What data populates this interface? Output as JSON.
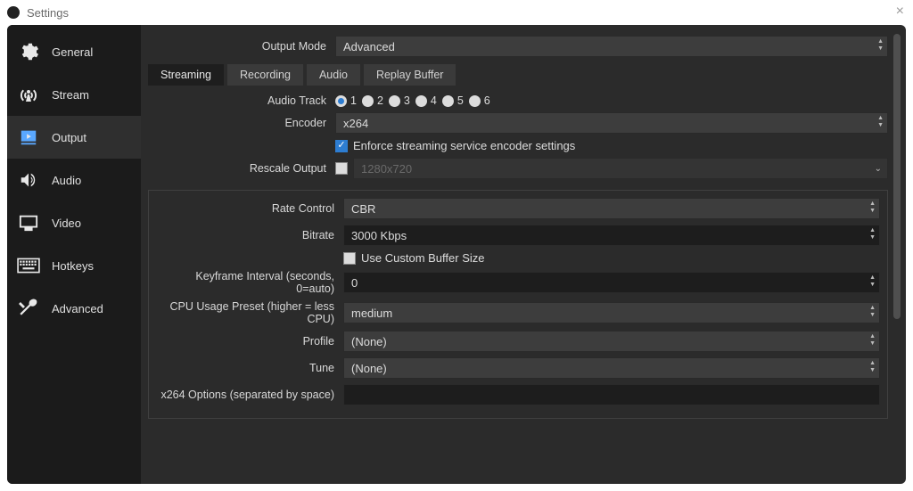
{
  "window": {
    "title": "Settings"
  },
  "sidebar": {
    "items": [
      {
        "label": "General"
      },
      {
        "label": "Stream"
      },
      {
        "label": "Output"
      },
      {
        "label": "Audio"
      },
      {
        "label": "Video"
      },
      {
        "label": "Hotkeys"
      },
      {
        "label": "Advanced"
      }
    ],
    "active_index": 2
  },
  "output_mode": {
    "label": "Output Mode",
    "value": "Advanced"
  },
  "tabs": {
    "items": [
      {
        "label": "Streaming"
      },
      {
        "label": "Recording"
      },
      {
        "label": "Audio"
      },
      {
        "label": "Replay Buffer"
      }
    ],
    "active_index": 0
  },
  "streaming": {
    "audio_track": {
      "label": "Audio Track",
      "options": [
        "1",
        "2",
        "3",
        "4",
        "5",
        "6"
      ],
      "selected": "1"
    },
    "encoder": {
      "label": "Encoder",
      "value": "x264"
    },
    "enforce": {
      "checked": true,
      "label": "Enforce streaming service encoder settings"
    },
    "rescale": {
      "label": "Rescale Output",
      "checked": false,
      "placeholder": "1280x720"
    },
    "rate_control": {
      "label": "Rate Control",
      "value": "CBR"
    },
    "bitrate": {
      "label": "Bitrate",
      "value": "3000 Kbps"
    },
    "custom_buffer": {
      "checked": false,
      "label": "Use Custom Buffer Size"
    },
    "keyframe": {
      "label": "Keyframe Interval (seconds, 0=auto)",
      "value": "0"
    },
    "cpu_preset": {
      "label": "CPU Usage Preset (higher = less CPU)",
      "value": "medium"
    },
    "profile": {
      "label": "Profile",
      "value": "(None)"
    },
    "tune": {
      "label": "Tune",
      "value": "(None)"
    },
    "x264_options": {
      "label": "x264 Options (separated by space)",
      "value": ""
    }
  }
}
